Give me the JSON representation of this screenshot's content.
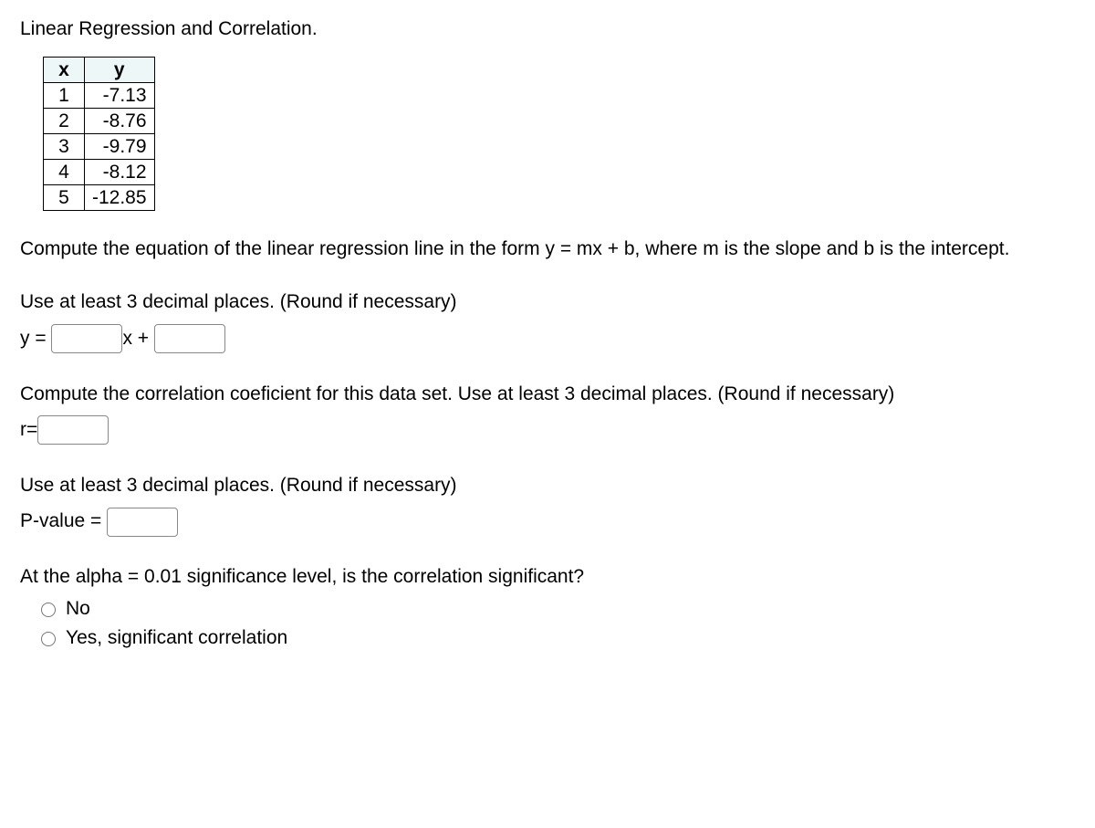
{
  "title": "Linear Regression and Correlation.",
  "table": {
    "headers": {
      "x": "x",
      "y": "y"
    },
    "rows": [
      {
        "x": "1",
        "y": "-7.13"
      },
      {
        "x": "2",
        "y": "-8.76"
      },
      {
        "x": "3",
        "y": "-9.79"
      },
      {
        "x": "4",
        "y": "-8.12"
      },
      {
        "x": "5",
        "y": "-12.85"
      }
    ]
  },
  "prompt1": "Compute the equation of the linear regression line in the form y = mx + b, where m is the slope and b is the intercept.",
  "decimals_hint": "Use at least 3 decimal places. (Round if necessary)",
  "eq": {
    "prefix": "y = ",
    "mid": "x + "
  },
  "prompt2": "Compute the correlation coeficient for this data set. Use at least 3 decimal places. (Round if necessary)",
  "r_label": "r=",
  "pvalue_label": "P-value = ",
  "sig_question": "At the alpha = 0.01 significance level, is the correlation significant?",
  "options": {
    "no": "No",
    "yes": "Yes, significant correlation"
  }
}
